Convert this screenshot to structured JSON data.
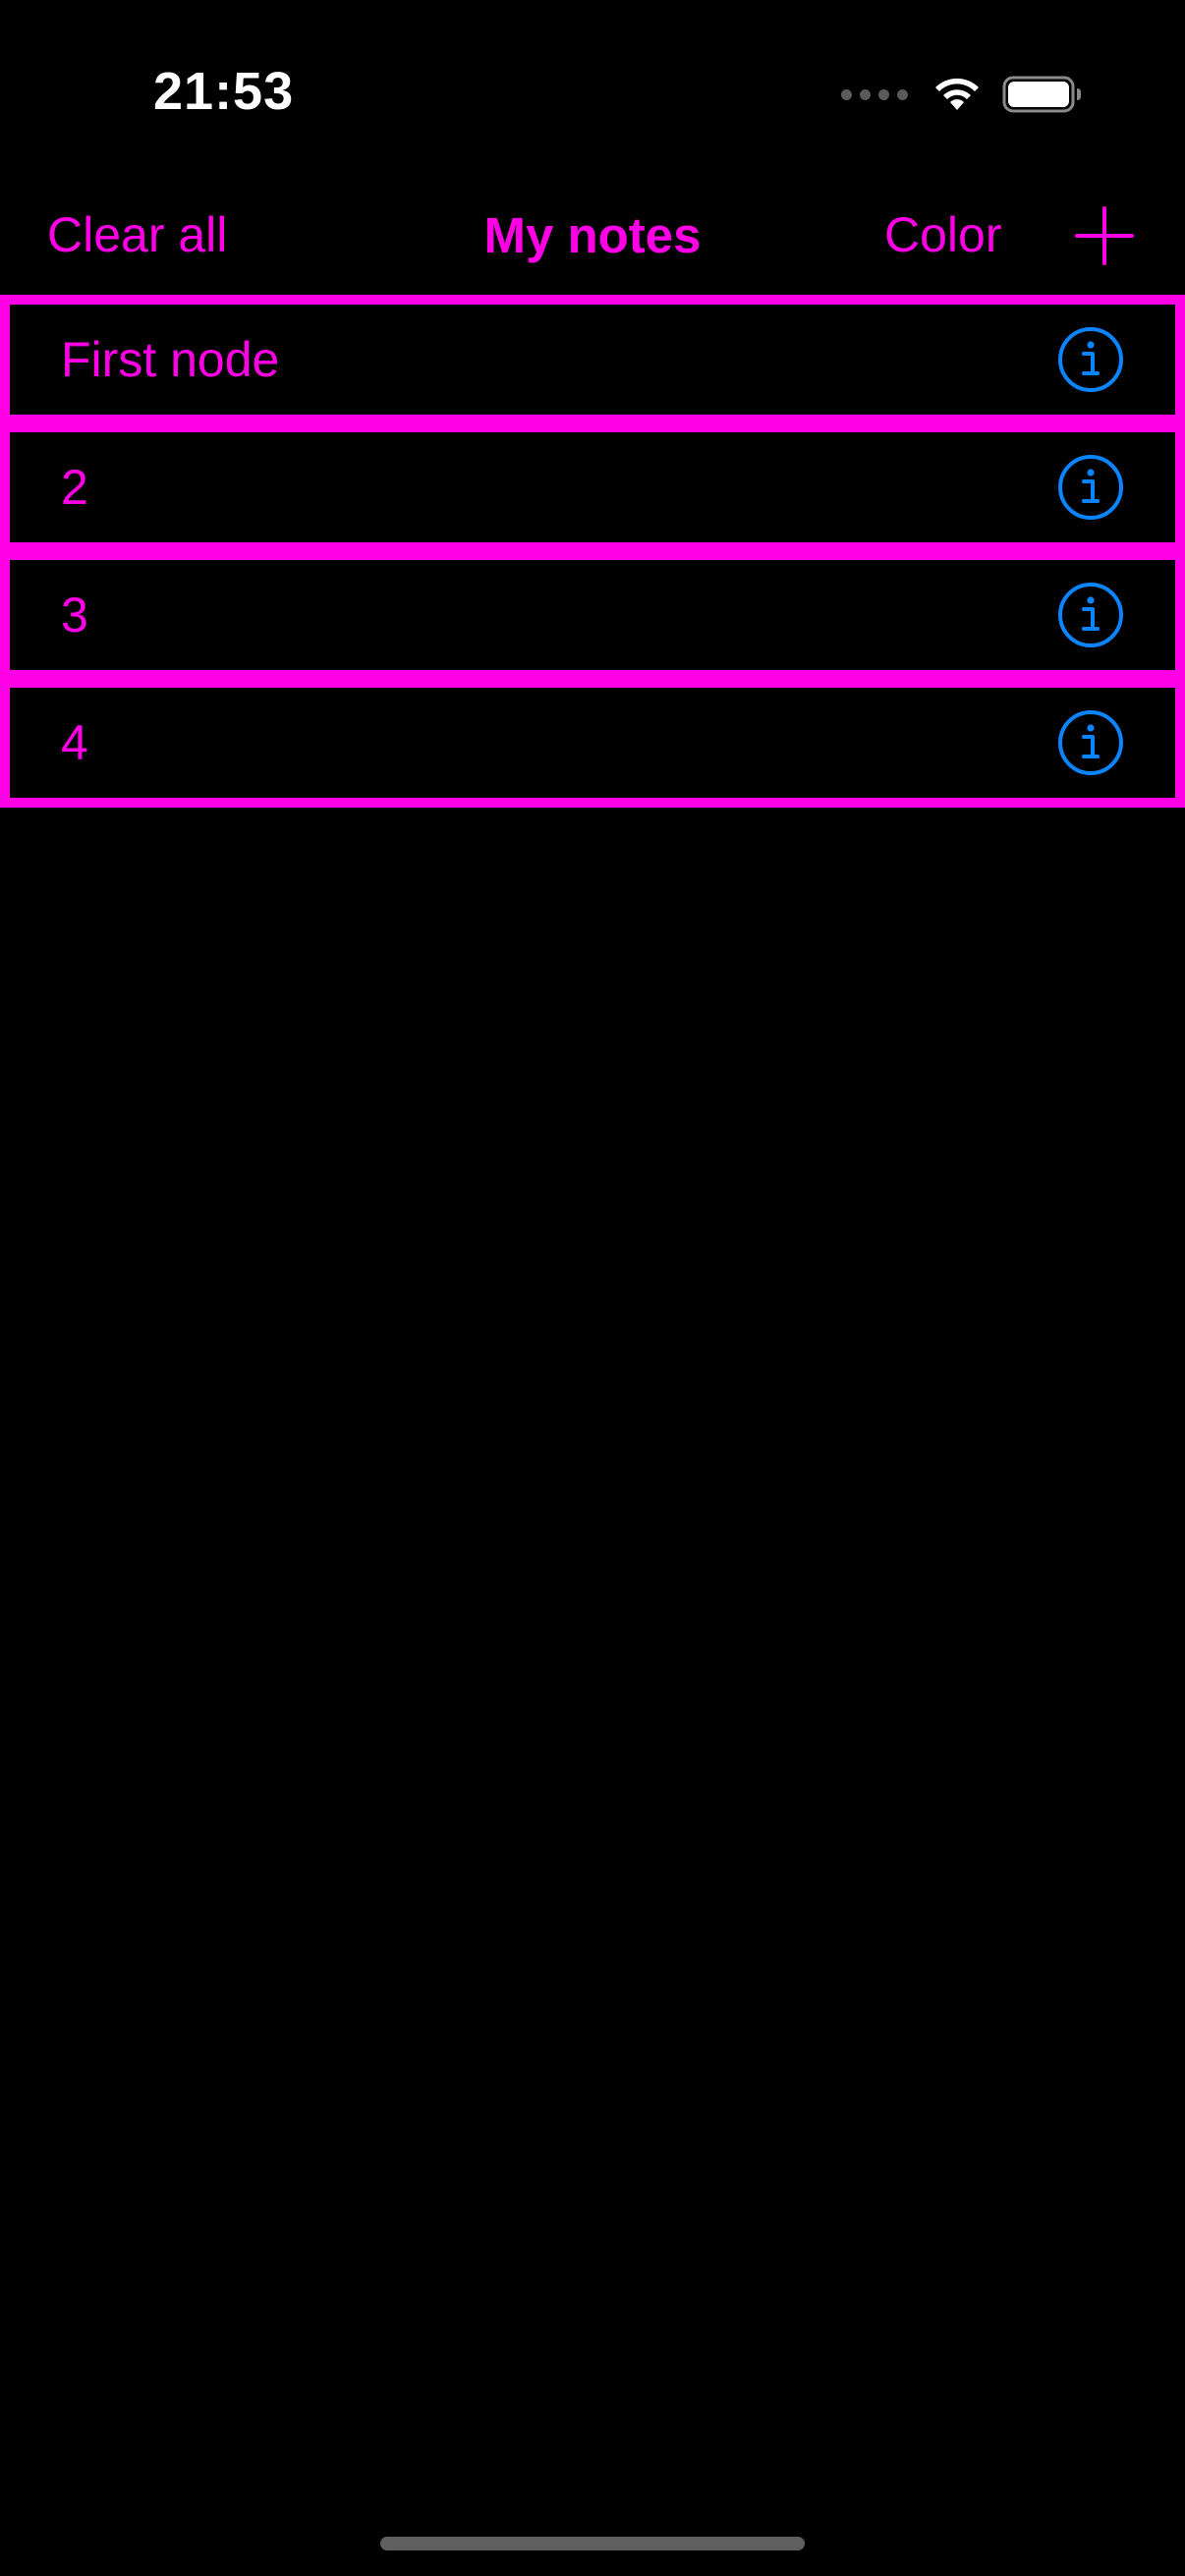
{
  "status_bar": {
    "time": "21:53",
    "icons": [
      "signal-dots-icon",
      "wifi-icon",
      "battery-icon"
    ]
  },
  "nav": {
    "clear_label": "Clear all",
    "title": "My notes",
    "color_label": "Color",
    "add_icon": "plus-icon"
  },
  "notes": [
    {
      "label": "First node"
    },
    {
      "label": "2"
    },
    {
      "label": "3"
    },
    {
      "label": "4"
    }
  ],
  "colors": {
    "accent": "#ff00e6",
    "info": "#0a84ff",
    "background": "#000000",
    "status_text": "#ffffff"
  }
}
